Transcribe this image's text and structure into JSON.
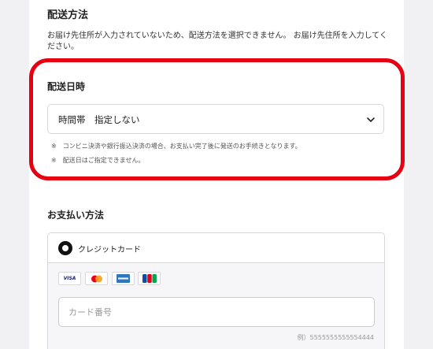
{
  "shipping_method": {
    "title": "配送方法",
    "note": "お届け先住所が入力されていないため、配送方法を選択できません。 お届け先住所を入力してください。"
  },
  "delivery_date": {
    "title": "配送日時",
    "select_value": "時間帯　指定しない",
    "note1": "※　コンビニ決済や銀行振込決済の場合、お支払い完了後に発送のお手続きとなります。",
    "note2": "※　配送日はご指定できません。"
  },
  "payment": {
    "title": "お支払い方法",
    "option_label": "クレジットカード",
    "brands": [
      "VISA",
      "Mastercard",
      "AMEX",
      "JCB"
    ],
    "card_number_placeholder": "カード番号",
    "card_number_value": "",
    "example": "例）5555555555554444"
  },
  "colors": {
    "highlight": "#e60012",
    "border": "#d7d7db"
  },
  "icons": {
    "select_chevron": "chevron-down-icon",
    "radio": "radio-selected-icon"
  }
}
